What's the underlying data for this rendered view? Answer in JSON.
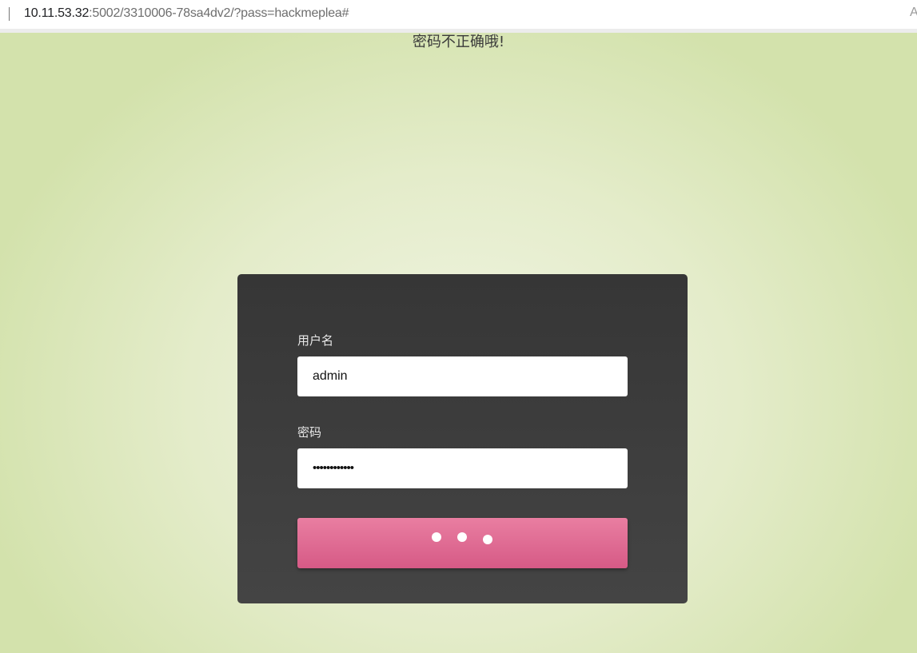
{
  "browser": {
    "url_host": "10.11.53.32",
    "url_rest": ":5002/3310006-78sa4dv2/?pass=hackmeplea#",
    "right_edge_char": "A"
  },
  "page": {
    "error_message": "密码不正确哦!"
  },
  "login_form": {
    "username_label": "用户名",
    "username_value": "admin",
    "password_label": "密码",
    "password_masked": "••••••••••••",
    "submit_state": "loading"
  },
  "colors": {
    "card_background": "#3c3c3c",
    "button_accent": "#e06a92",
    "page_background": "#e4ecca"
  }
}
